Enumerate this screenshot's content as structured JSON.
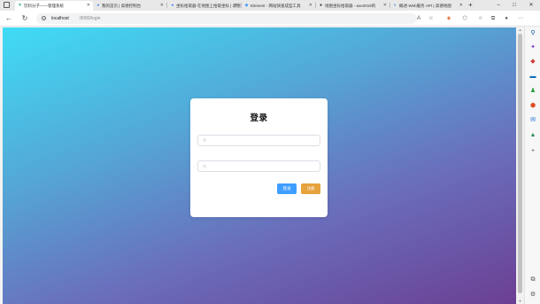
{
  "browser": {
    "tabs": [
      {
        "title": "饮料分子——管理系统",
        "active": true,
        "favicon": "vue-icon",
        "color": "#41b883"
      },
      {
        "title": "我的首页 | 高德控制台",
        "active": false,
        "favicon": "amap-icon",
        "color": "#3d7bf7"
      },
      {
        "title": "坐标拾取器-在地图上拾取坐标 | 高德",
        "active": false,
        "favicon": "amap-icon",
        "color": "#3d7bf7"
      },
      {
        "title": "Element - 网站快速成型工具",
        "active": false,
        "favicon": "element-icon",
        "color": "#409eff"
      },
      {
        "title": "地图坐标拾取器 - axe2019的",
        "active": false,
        "favicon": "github-icon",
        "color": "#333333"
      },
      {
        "title": "概述-Web服务 API | 高德地图",
        "active": false,
        "favicon": "edge-icon",
        "color": "#0c7bd6"
      }
    ],
    "new_tab_label": "+",
    "address": {
      "host": "localhost",
      "path": ":8080/login"
    },
    "window_controls": {
      "minimize": "–",
      "maximize": "□",
      "close": "✕"
    }
  },
  "login": {
    "title": "登录",
    "username_placeholder": "",
    "password_placeholder": "",
    "login_button": "登录",
    "register_button": "注册"
  },
  "sidebar": {
    "icons": [
      {
        "name": "search-icon",
        "glyph": "⚲",
        "color": "#0c59a4"
      },
      {
        "name": "sparkle-icon",
        "glyph": "✦",
        "color": "#7a3fd6"
      },
      {
        "name": "tag-icon",
        "glyph": "◆",
        "color": "#d23a3a"
      },
      {
        "name": "briefcase-icon",
        "glyph": "▬",
        "color": "#0f6cbd"
      },
      {
        "name": "games-icon",
        "glyph": "♟",
        "color": "#2aa13f"
      },
      {
        "name": "office-icon",
        "glyph": "⬢",
        "color": "#e04a1f"
      },
      {
        "name": "outlook-icon",
        "glyph": "✉",
        "color": "#0a64c8"
      },
      {
        "name": "tree-icon",
        "glyph": "▲",
        "color": "#2e8b57"
      },
      {
        "name": "add-icon",
        "glyph": "+",
        "color": "#555555"
      }
    ],
    "bottom_icons": [
      {
        "name": "screenshot-icon",
        "glyph": "⧉",
        "color": "#555555"
      },
      {
        "name": "settings-icon",
        "glyph": "⚙",
        "color": "#555555"
      }
    ]
  },
  "colors": {
    "login_button": "#409eff",
    "register_button": "#e6a23c",
    "gradient_start": "#3fdcf5",
    "gradient_end": "#6b3f93"
  }
}
